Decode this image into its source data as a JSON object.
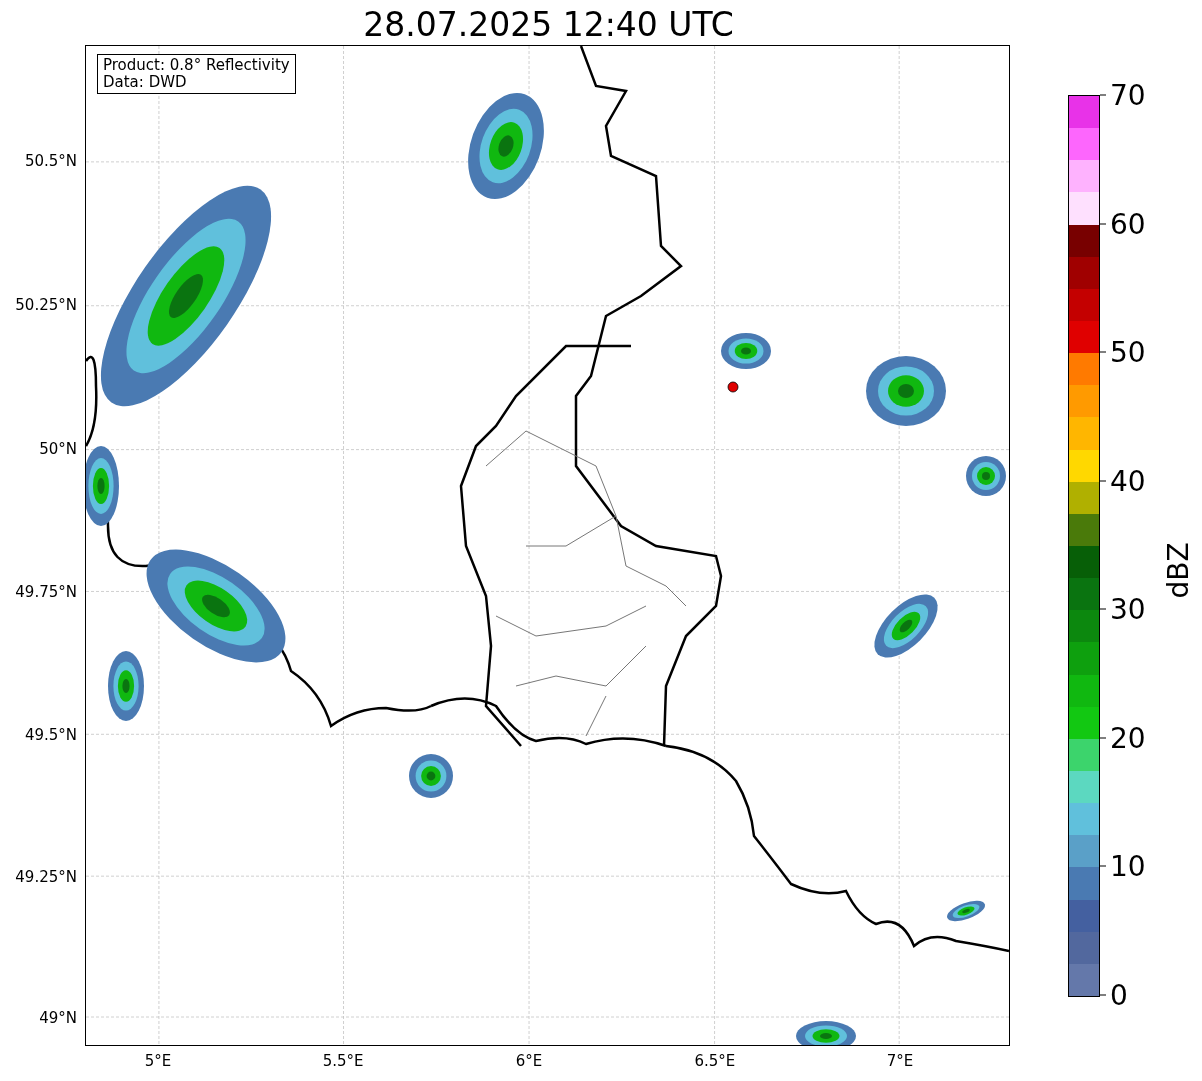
{
  "title": "28.07.2025 12:40 UTC",
  "info_box": [
    "Product: 0.8° Reflectivity",
    "Data: DWD"
  ],
  "lat_ticks": [
    "50.5°N",
    "50.25°N",
    "50°N",
    "49.75°N",
    "49.5°N",
    "49.25°N",
    "49°N"
  ],
  "lon_ticks": [
    "5°E",
    "5.5°E",
    "6°E",
    "6.5°E",
    "7°E"
  ],
  "colorbar": {
    "label": "dBZ",
    "ticks": [
      "70",
      "60",
      "50",
      "40",
      "30",
      "20",
      "10",
      "0"
    ],
    "segments": [
      {
        "color": "#e832e8"
      },
      {
        "color": "#fd66fd"
      },
      {
        "color": "#feb2fe"
      },
      {
        "color": "#fee0fe"
      },
      {
        "color": "#780000"
      },
      {
        "color": "#a00000"
      },
      {
        "color": "#c40000"
      },
      {
        "color": "#e00000"
      },
      {
        "color": "#ff7a00"
      },
      {
        "color": "#ff9a00"
      },
      {
        "color": "#ffb600"
      },
      {
        "color": "#ffd800"
      },
      {
        "color": "#b0b000"
      },
      {
        "color": "#4a7a0a"
      },
      {
        "color": "#075f07"
      },
      {
        "color": "#0a7410"
      },
      {
        "color": "#0c880e"
      },
      {
        "color": "#0ea00e"
      },
      {
        "color": "#10b810"
      },
      {
        "color": "#12c812"
      },
      {
        "color": "#3cd46c"
      },
      {
        "color": "#5cd8c0"
      },
      {
        "color": "#60c0dc"
      },
      {
        "color": "#5aa0c8"
      },
      {
        "color": "#4a7ab2"
      },
      {
        "color": "#4460a0"
      },
      {
        "color": "#52689e"
      },
      {
        "color": "#6478aa"
      }
    ]
  }
}
